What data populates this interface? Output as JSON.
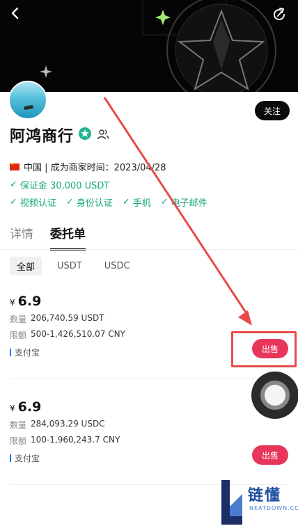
{
  "merchant": {
    "name": "阿鸿商行",
    "follow_label": "关注",
    "meta": "中国 | 成为商家时间：2023/04/28",
    "deposit": "保证金 30,000 USDT",
    "verifications": [
      "视频认证",
      "身份认证",
      "手机",
      "电子邮件"
    ]
  },
  "tabs": [
    {
      "label": "详情",
      "active": false
    },
    {
      "label": "委托单",
      "active": true
    }
  ],
  "filters": [
    {
      "label": "全部",
      "active": true
    },
    {
      "label": "USDT",
      "active": false
    },
    {
      "label": "USDC",
      "active": false
    }
  ],
  "offers": [
    {
      "currency_symbol": "¥",
      "price": "6.9",
      "quantity_label": "数量",
      "quantity": "206,740.59 USDT",
      "limit_label": "限额",
      "limit": "500-1,426,510.07 CNY",
      "payment": "支付宝",
      "action": "出售"
    },
    {
      "currency_symbol": "¥",
      "price": "6.9",
      "quantity_label": "数量",
      "quantity": "284,093.29 USDC",
      "limit_label": "限额",
      "limit": "100-1,960,243.7 CNY",
      "payment": "支付宝",
      "action": "出售"
    }
  ],
  "watermark": {
    "title": "链懂",
    "subtitle": "NEATDOWN.COM"
  },
  "colors": {
    "accent_red": "#e8365b",
    "verify_green": "#17a97b",
    "annotation_red": "#e84a4a"
  },
  "icons": [
    "back-icon",
    "share-icon",
    "verified-badge-icon",
    "people-icon",
    "check-icon",
    "alipay-mark-icon"
  ]
}
